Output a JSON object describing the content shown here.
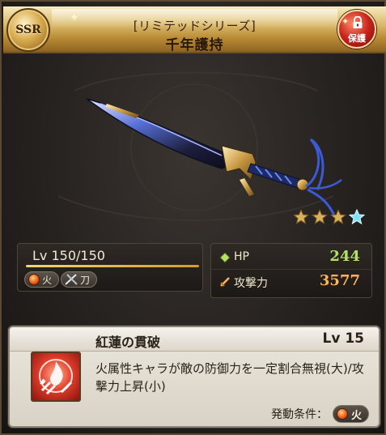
{
  "header": {
    "rarity": "SSR",
    "series": "[リミテッドシリーズ]",
    "name": "千年護持",
    "lock_label": "保護"
  },
  "weapon": {
    "image_icon": "blue-golden-sword",
    "rarity_stars_filled": 3,
    "rarity_stars_total": 4
  },
  "level": {
    "text": "Lv 150/150",
    "progress": 1.0,
    "element_label": "火",
    "type_label": "刀"
  },
  "stats": {
    "hp_label": "HP",
    "hp_value": "244",
    "atk_label": "攻撃力",
    "atk_value": "3577"
  },
  "skill": {
    "name": "紅蓮の貫破",
    "level": "Lv 15",
    "description": "火属性キャラが敵の防御力を一定割合無視(大)/攻撃力上昇(小)",
    "condition_label": "発動条件：",
    "condition_element": "火"
  },
  "colors": {
    "hp": "#b7e06a",
    "atk": "#ffb55a",
    "fire": "#f06a1c",
    "gold": "#d9b868"
  }
}
